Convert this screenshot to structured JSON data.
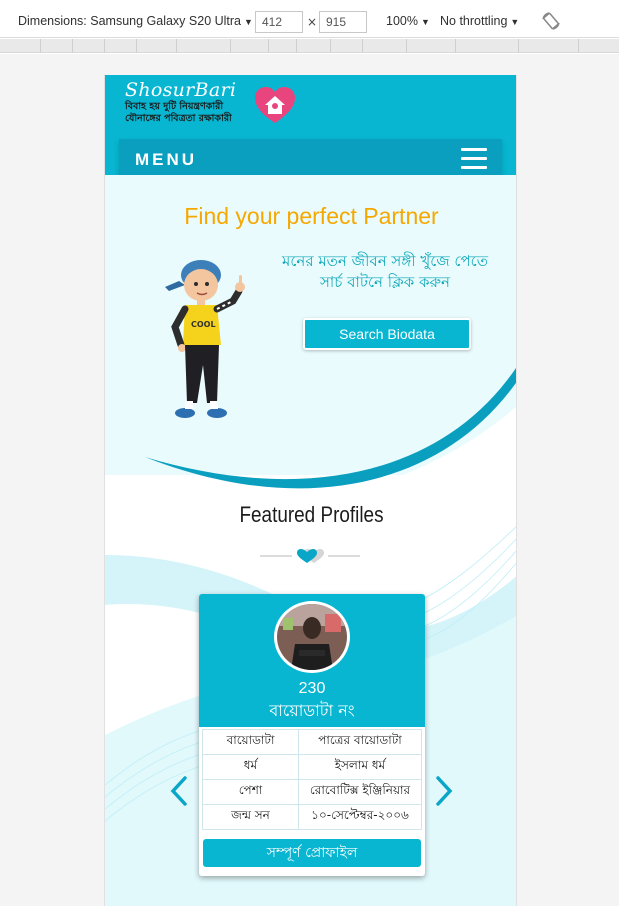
{
  "devtools": {
    "dimensions_label": "Dimensions: Samsung Galaxy S20 Ultra",
    "width": "412",
    "separator": "×",
    "height": "915",
    "zoom": "100%",
    "throttling": "No throttling"
  },
  "header": {
    "brand": "ShosurBari",
    "tagline_1": "বিবাহ হয় দুটি নিয়ন্ত্রণকারী",
    "tagline_2": "যৌনাঙ্গের পবিত্রতা রক্ষাকারী",
    "menu_label": "MENU"
  },
  "hero": {
    "title": "Find your perfect Partner",
    "text_line_1": "মনের মতন জীবন সঙ্গী খুঁজে পেতে",
    "text_line_2": "সার্চ বাটনে ক্লিক করুন",
    "search_button": "Search Biodata"
  },
  "featured": {
    "title": "Featured Profiles",
    "card": {
      "number": "230",
      "biodata_label": "বায়োডাটা নং",
      "rows": [
        {
          "label": "বায়োডাটা",
          "value": "পাত্রের বায়োডাটা"
        },
        {
          "label": "ধর্ম",
          "value": "ইসলাম ধর্ম"
        },
        {
          "label": "পেশা",
          "value": "রোবোটিক্স ইঞ্জিনিয়ার"
        },
        {
          "label": "জন্ম সন",
          "value": "১০-সেপ্টেম্বর-২০০৬"
        }
      ],
      "full_profile_button": "সম্পূর্ণ প্রোফাইল"
    }
  },
  "colors": {
    "primary": "#08b6d1",
    "accent_title": "#f5a800",
    "hero_text": "#0ba7b8"
  }
}
